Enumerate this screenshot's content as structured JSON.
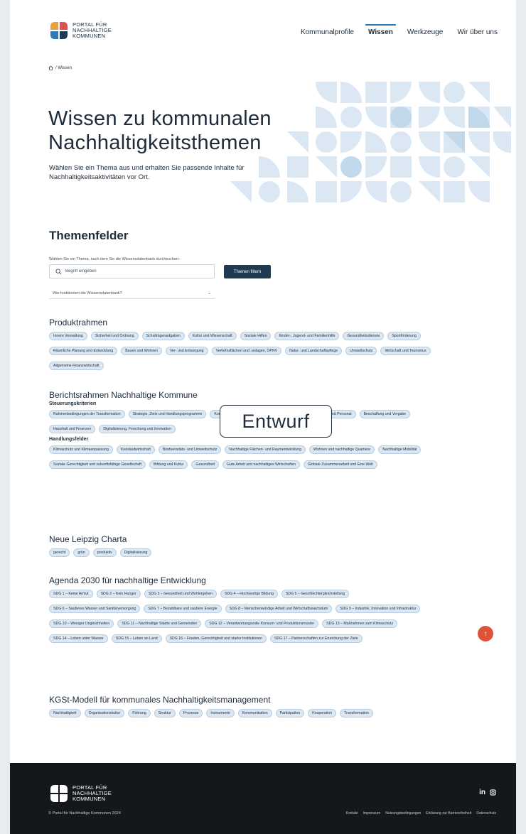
{
  "brand": {
    "line1": "PORTAL FÜR",
    "line2": "NACHHALTIGE",
    "line3": "KOMMUNEN"
  },
  "nav": [
    {
      "label": "Kommunalprofile",
      "active": false
    },
    {
      "label": "Wissen",
      "active": true
    },
    {
      "label": "Werkzeuge",
      "active": false
    },
    {
      "label": "Wir über uns",
      "active": false
    }
  ],
  "breadcrumb": {
    "current": "/ Wissen"
  },
  "hero": {
    "title_line1": "Wissen zu kommunalen",
    "title_line2": "Nachhaltigkeitsthemen",
    "subtitle": "Wählen Sie ein Thema aus und erhalten Sie passende Inhalte für Nachhaltigkeitsaktivitäten vor Ort."
  },
  "themen": {
    "title": "Themenfelder",
    "search_label": "Wählen Sie ein Thema, nach dem Sie die Wissensdatenbank durchsuchen:",
    "search_placeholder": "Begriff eingeben",
    "filter_button": "Themen filtern",
    "accordion_label": "Wie funktioniert die Wissensdatenbank?"
  },
  "groups": {
    "produktrahmen": {
      "title": "Produktrahmen",
      "chips": [
        "Innere Verwaltung",
        "Sicherheit und Ordnung",
        "Schulträgeraufgaben",
        "Kultur und Wissenschaft",
        "Soziale Hilfen",
        "Kinder-, Jugend- und Familienhilfe",
        "Gesundheitsdienste",
        "Sportförderung",
        "Räumliche Planung und Entwicklung",
        "Bauen und Wohnen",
        "Ver- und Entsorgung",
        "Verkehrsflächen und -anlagen, ÖPNV",
        "Natur- und Landschaftspflege",
        "Umweltschutz",
        "Wirtschaft und Tourismus",
        "Allgemeine Finanzwirtschaft"
      ]
    },
    "berichtsrahmen": {
      "title": "Berichtsrahmen Nachhaltige Kommune",
      "sub1": "Steuerungskriterien",
      "chips1": [
        "Rahmenbedingungen der Transformation",
        "Strategie, Ziele und Handlungsprogramme",
        "Kommunikation, Beteiligung und Zusammenarbeit",
        "Organisation und Personal",
        "Beschaffung und Vergabe",
        "Haushalt und Finanzen",
        "Digitalisierung, Forschung und Innovation"
      ],
      "sub2": "Handlungsfelder",
      "chips2": [
        "Klimaschutz und Klimaanpassung",
        "Kreislaufwirtschaft",
        "Biodiversitäts- und Umweltschutz",
        "Nachhaltige Flächen- und Raumentwicklung",
        "Wohnen und nachhaltige Quartiere",
        "Nachhaltige Mobilität",
        "Soziale Gerechtigkeit und zukunftsfähige Gesellschaft",
        "Bildung und Kultur",
        "Gesundheit",
        "Gute Arbeit und nachhaltiges Wirtschaften",
        "Globale Zusammenarbeit und Eine Welt"
      ]
    },
    "leipzig": {
      "title": "Neue Leipzig Charta",
      "chips": [
        "gerecht",
        "grün",
        "produktiv",
        "Digitalisierung"
      ]
    },
    "agenda": {
      "title": "Agenda 2030 für nachhaltige Entwicklung",
      "chips": [
        "SDG 1 – Keine Armut",
        "SDG 2 – Kein Hunger",
        "SDG 3 – Gesundheit und Wohlergehen",
        "SDG 4 – Hochwertige Bildung",
        "SDG 5 – Geschlechtergleichstellung",
        "SDG 6 – Sauberes Wasser und Sanitärversorgung",
        "SDG 7 – Bezahlbare und saubere Energie",
        "SDG 8 – Menschenwürdige Arbeit und Wirtschaftswachstum",
        "SDG 9 – Industrie, Innovation und Infrastruktur",
        "SDG 10 – Weniger Ungleichheiten",
        "SDG 11 – Nachhaltige Städte und Gemeinden",
        "SDG 12 – Verantwortungsvolle Konsum- und Produktionsmuster",
        "SDG 13 – Maßnahmen zum Klimaschutz",
        "SDG 14 – Leben unter Wasser",
        "SDG 15 – Leben an Land",
        "SDG 16 – Frieden, Gerechtigkeit und starke Institutionen",
        "SDG 17 – Partnerschaften zur Erreichung der Ziele"
      ]
    },
    "kgst": {
      "title": "KGSt-Modell für kommunales Nachhaltigkeitsmanagement",
      "chips": [
        "Nachhaltigkeit",
        "Organisationskultur",
        "Führung",
        "Struktur",
        "Prozesse",
        "Instrumente",
        "Kommunikation",
        "Partizipation",
        "Kooperation",
        "Transformation"
      ]
    }
  },
  "stamp": "Entwurf",
  "footer": {
    "social": "in",
    "copyright": "© Portal für Nachhaltige Kommunen 2024",
    "links": [
      "Kontakt",
      "Impressum",
      "Nutzungsbedingungen",
      "Erklärung zur Barrierefreiheit",
      "Datenschutz"
    ]
  },
  "colors": {
    "accent": "#2b7bb9",
    "chip_bg": "#dbe7f2",
    "button_bg": "#1f3a52",
    "footer_bg": "#14181d",
    "to_top": "#e0533b"
  }
}
